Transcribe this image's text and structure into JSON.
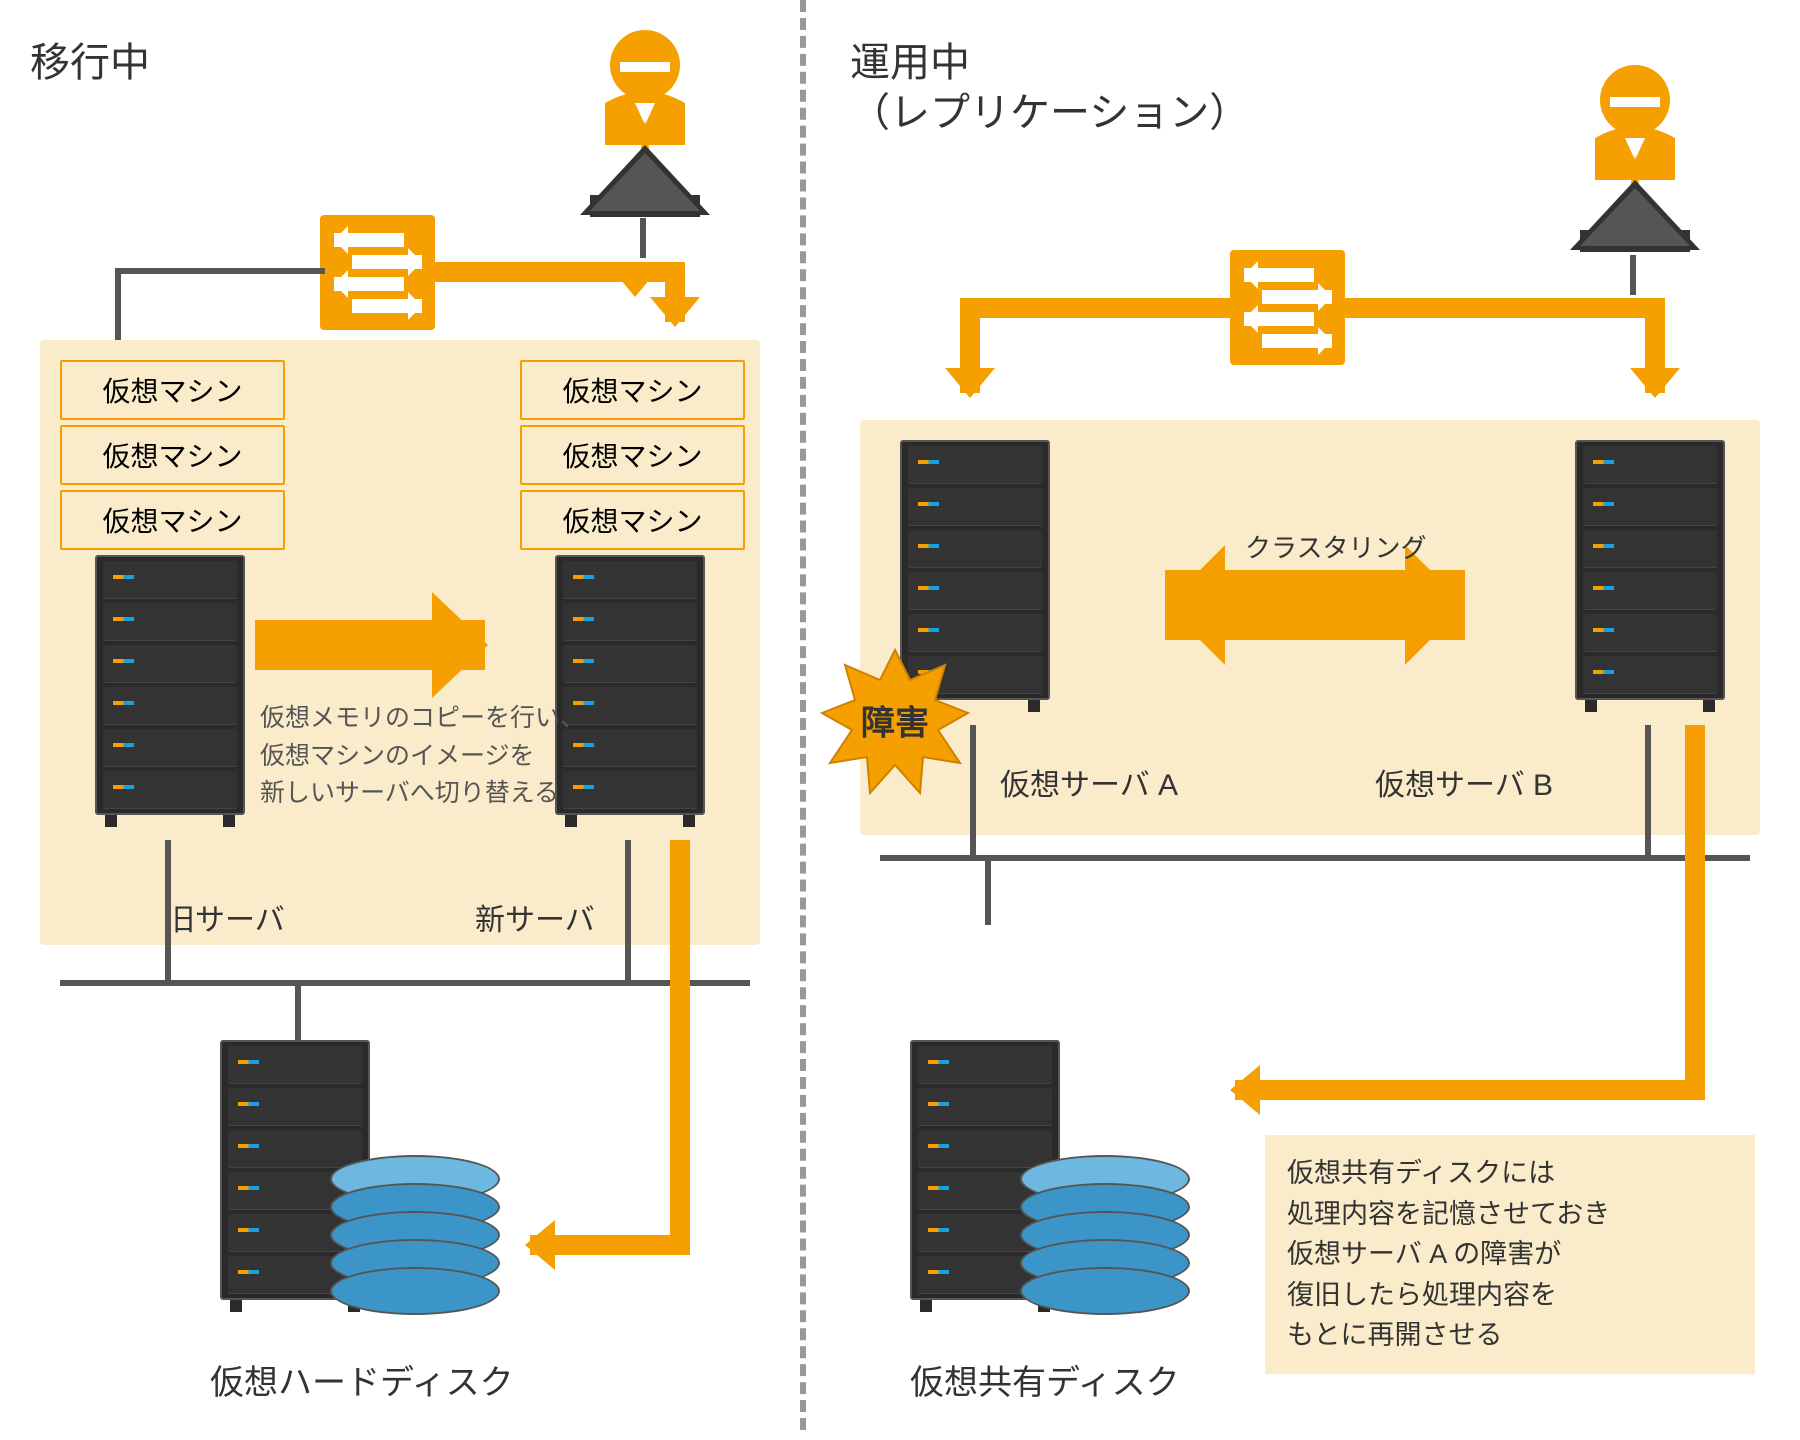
{
  "left": {
    "title": "移行中",
    "vm_label": "仮想マシン",
    "old_server": "旧サーバ",
    "new_server": "新サーバ",
    "migration_desc": "仮想メモリのコピーを行い、\n仮想マシンのイメージを\n新しいサーバへ切り替える",
    "disk_label": "仮想ハードディスク"
  },
  "right": {
    "title_line1": "運用中",
    "title_line2": "（レプリケーション）",
    "clustering": "クラスタリング",
    "failure": "障害",
    "server_a": "仮想サーバ A",
    "server_b": "仮想サーバ B",
    "callout": "仮想共有ディスクには\n処理内容を記憶させておき\n仮想サーバ A の障害が\n復旧したら処理内容を\nもとに再開させる",
    "disk_label": "仮想共有ディスク"
  }
}
